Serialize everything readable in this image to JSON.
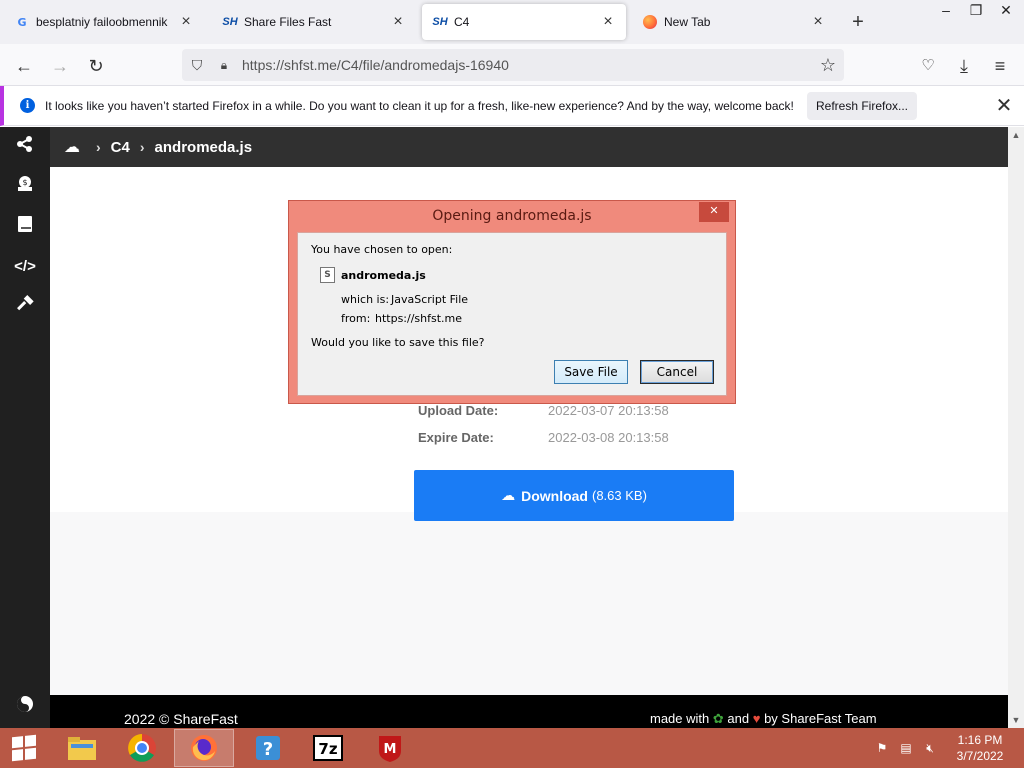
{
  "browser": {
    "tabs": [
      {
        "title": "besplatniy failoobmennik - G",
        "icon": "google-g-icon"
      },
      {
        "title": "Share Files Fast",
        "icon": "sharefast-icon"
      },
      {
        "title": "C4",
        "icon": "sharefast-icon",
        "active": true
      },
      {
        "title": "New Tab",
        "icon": "firefox-icon"
      }
    ],
    "url": "https://shfst.me/C4/file/andromedajs-16940"
  },
  "notification": {
    "message": "It looks like you haven’t started Firefox in a while. Do you want to clean it up for a fresh, like-new experience? And by the way, welcome back!",
    "button": "Refresh Firefox..."
  },
  "site": {
    "breadcrumb": [
      "C4",
      "andromeda.js"
    ],
    "info": [
      {
        "label": "Upload Date:",
        "value": "2022-03-07 20:13:58"
      },
      {
        "label": "Expire Date:",
        "value": "2022-03-08 20:13:58"
      }
    ],
    "download": {
      "label": "Download",
      "size": "(8.63 KB)"
    },
    "footer": {
      "copyright": "2022 © ShareFast",
      "made_with": "made with",
      "and": "and",
      "by": "by ShareFast Team"
    }
  },
  "dialog": {
    "title": "Opening andromeda.js",
    "intro": "You have chosen to open:",
    "filename": "andromeda.js",
    "which_is_label": "which is:",
    "which_is_value": "JavaScript File",
    "from_label": "from:",
    "from_value": "https://shfst.me",
    "question": "Would you like to save this file?",
    "save_button": "Save File",
    "cancel_button": "Cancel"
  },
  "taskbar": {
    "time": "1:16 PM",
    "date": "3/7/2022",
    "apps": [
      "file-explorer",
      "chrome",
      "firefox",
      "help",
      "7zip",
      "mcafee"
    ]
  },
  "colors": {
    "accent": "#1a7cf5",
    "sidebar": "#202020",
    "taskbar": "#b85845",
    "dialog_frame": "#f08a7c"
  }
}
